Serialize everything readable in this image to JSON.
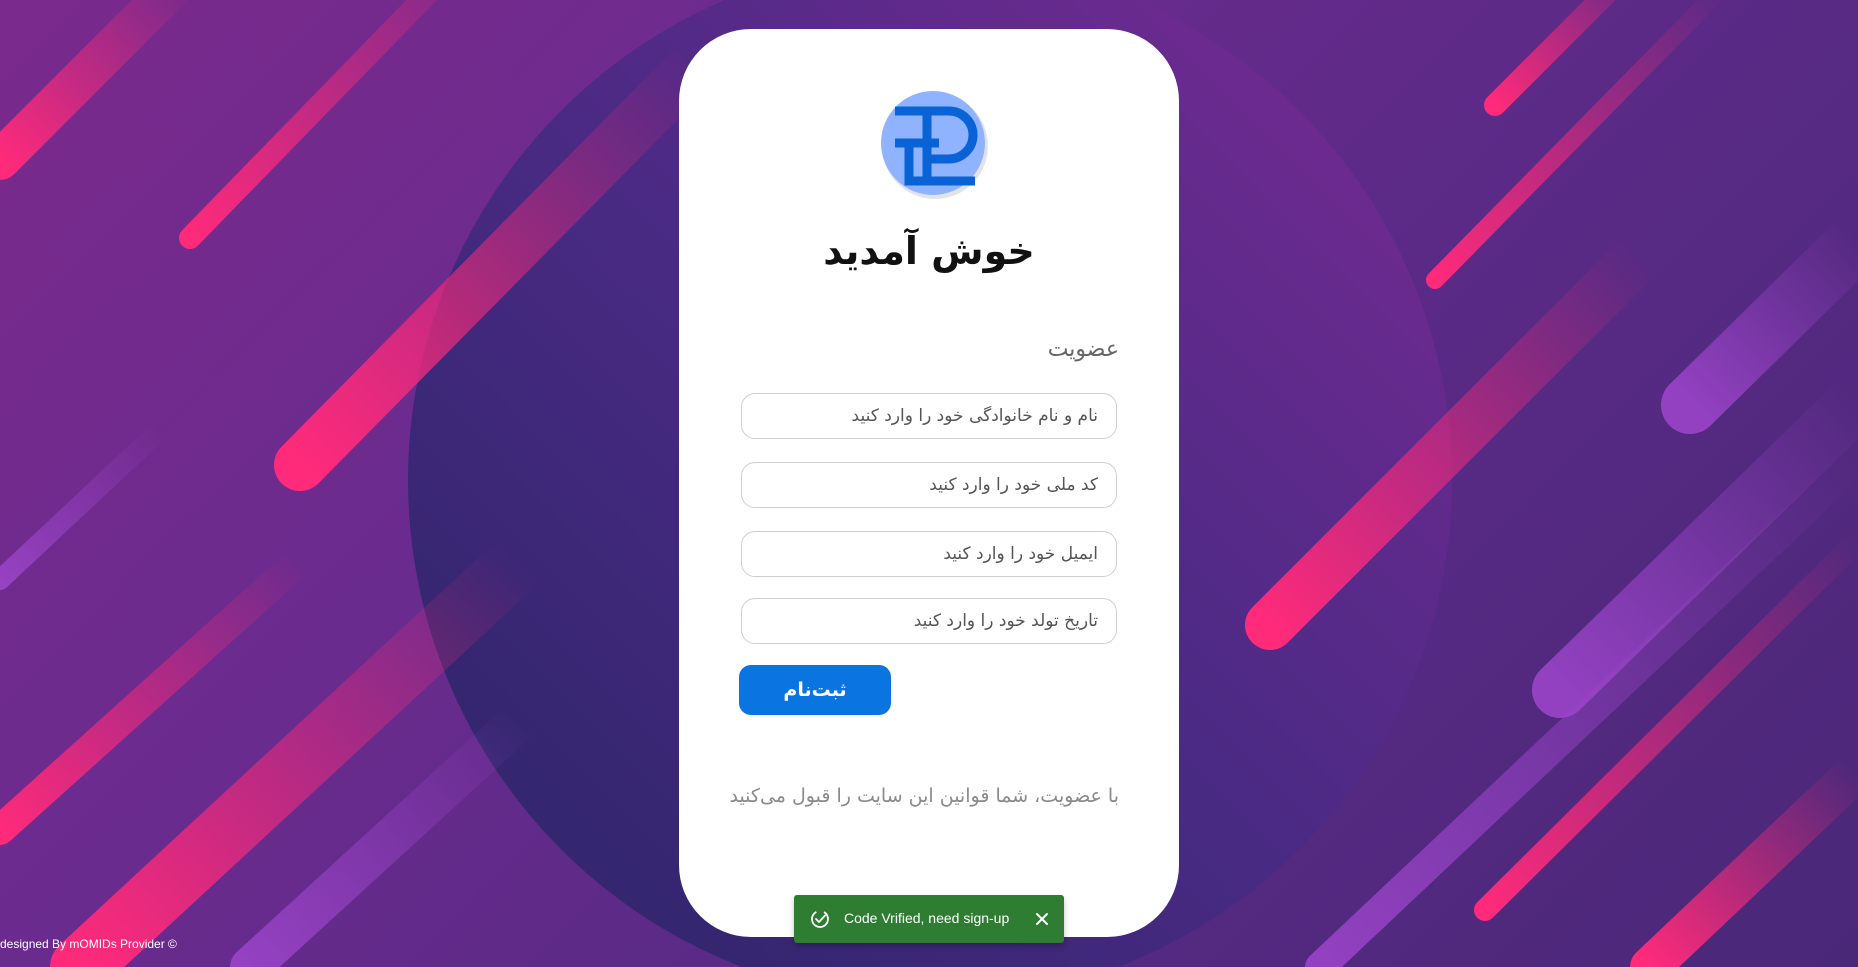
{
  "card": {
    "title": "خوش آمدید",
    "section_label": "عضویت",
    "fields": {
      "full_name_placeholder": "نام و نام خانوادگی خود را وارد کنید",
      "national_code_placeholder": "کد ملی خود را وارد کنید",
      "email_placeholder": "ایمیل خود را وارد کنید",
      "birth_date_placeholder": "تاریخ تولد خود را وارد کنید"
    },
    "submit_label": "ثبت‌نام",
    "terms_text": "با عضویت، شما قوانین این سایت را قبول می‌کنید"
  },
  "footer": {
    "credit": "designed By mOMIDs Provider ©"
  },
  "toast": {
    "message": "Code Vrified, need sign-up",
    "icon": "check-circle-icon",
    "close_icon": "close-icon"
  },
  "colors": {
    "primary_button": "#0a74e0",
    "toast_success": "#2e7d32",
    "background": "#6a2b8e",
    "accent_stripes": "#e0287a"
  }
}
